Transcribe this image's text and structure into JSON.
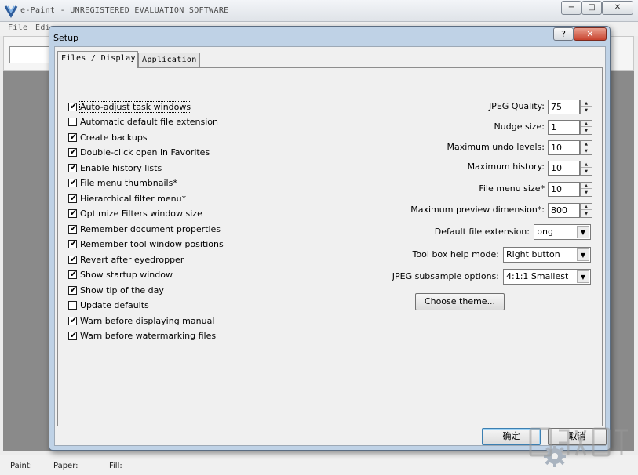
{
  "app": {
    "title": "e-Paint - UNREGISTERED EVALUATION SOFTWARE",
    "controls": {
      "minimize": "−",
      "maximize": "□",
      "close": "✕"
    },
    "menu": {
      "file": "File",
      "edit": "Edi"
    }
  },
  "status": {
    "paint": "Paint:",
    "paper": "Paper:",
    "fill": "Fill:"
  },
  "dialog": {
    "title": "Setup",
    "help": "?",
    "close": "✕",
    "tabs": [
      {
        "label": "Files / Display",
        "active": true
      },
      {
        "label": "Application",
        "active": false
      }
    ],
    "checkboxes": [
      {
        "label": "Auto-adjust task windows",
        "checked": true
      },
      {
        "label": "Automatic default file extension",
        "checked": false
      },
      {
        "label": "Create backups",
        "checked": true
      },
      {
        "label": "Double-click open in Favorites",
        "checked": true
      },
      {
        "label": "Enable history lists",
        "checked": true
      },
      {
        "label": "File menu thumbnails*",
        "checked": true
      },
      {
        "label": "Hierarchical filter menu*",
        "checked": true
      },
      {
        "label": "Optimize Filters window size",
        "checked": true
      },
      {
        "label": "Remember document properties",
        "checked": true
      },
      {
        "label": "Remember tool window positions",
        "checked": true
      },
      {
        "label": "Revert after eyedropper",
        "checked": true
      },
      {
        "label": "Show startup window",
        "checked": true
      },
      {
        "label": "Show tip of the day",
        "checked": true
      },
      {
        "label": "Update defaults",
        "checked": false
      },
      {
        "label": "Warn before displaying manual",
        "checked": true
      },
      {
        "label": "Warn before watermarking files",
        "checked": true
      }
    ],
    "spinners": [
      {
        "label": "JPEG Quality:",
        "value": "75"
      },
      {
        "label": "Nudge size:",
        "value": "1"
      },
      {
        "label": "Maximum undo levels:",
        "value": "10"
      },
      {
        "label": "Maximum history:",
        "value": "10"
      },
      {
        "label": "File menu size*",
        "value": "10"
      },
      {
        "label": "Maximum preview dimension*:",
        "value": "800"
      }
    ],
    "selects": [
      {
        "label": "Default file extension:",
        "value": "png"
      },
      {
        "label": "Tool box help mode:",
        "value": "Right button"
      },
      {
        "label": "JPEG subsample options:",
        "value": "4:1:1 Smallest"
      }
    ],
    "choose_theme": "Choose theme...",
    "ok": "确定",
    "cancel": "取消"
  },
  "icons": {
    "app_logo": "app-logo-icon",
    "gear": "gear-icon",
    "check": "✔",
    "arrow": "▼",
    "spin_up": "▲",
    "spin_down": "▼"
  }
}
